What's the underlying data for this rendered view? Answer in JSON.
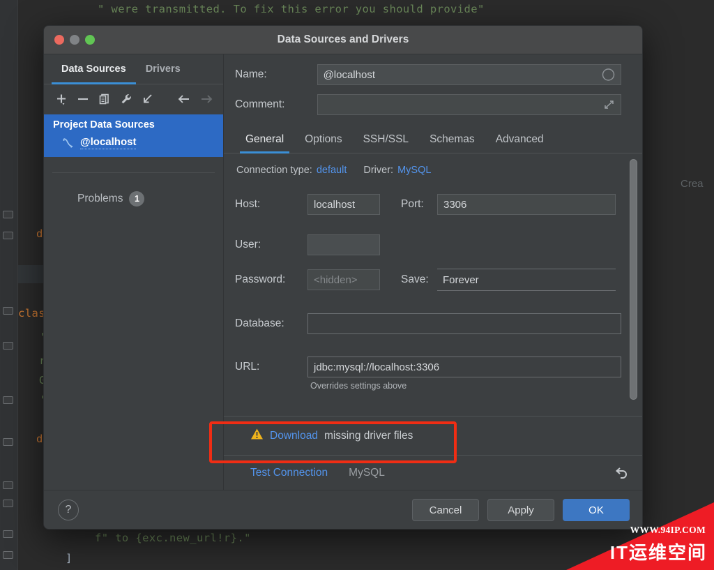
{
  "background": {
    "code_top": "\" were transmitted. To fix this error you should provide\"",
    "code_left_def1": "d",
    "code_left_class": "class",
    "code_left_str1": "\"",
    "code_left_str2": "r",
    "code_left_str3": "G",
    "code_left_str4": "\"",
    "code_left_def2": "d",
    "code_bottom_1": "f\" to {exc.new_url!r}.\"",
    "code_bottom_2": "]",
    "right_text": "Crea"
  },
  "dialog": {
    "title": "Data Sources and Drivers",
    "window_controls": {
      "close": "close-button",
      "minimize": "minimize-button",
      "maximize": "maximize-button"
    }
  },
  "sidebar": {
    "tabs": [
      {
        "label": "Data Sources",
        "active": true
      },
      {
        "label": "Drivers",
        "active": false
      }
    ],
    "toolbar": [
      {
        "icon": "add-icon",
        "name": "add-data-source-button",
        "enabled": true
      },
      {
        "icon": "remove-icon",
        "name": "remove-data-source-button",
        "enabled": true
      },
      {
        "icon": "duplicate-icon",
        "name": "duplicate-data-source-button",
        "enabled": true
      },
      {
        "icon": "wrench-icon",
        "name": "edit-driver-button",
        "enabled": true
      },
      {
        "icon": "import-icon",
        "name": "import-data-sources-button",
        "enabled": true
      },
      {
        "icon": "arrow-left-icon",
        "name": "navigate-back-button",
        "enabled": true
      },
      {
        "icon": "arrow-right-icon",
        "name": "navigate-forward-button",
        "enabled": false
      }
    ],
    "group_label": "Project Data Sources",
    "item_label": "@localhost",
    "item_icon": "mysql-datasource-icon",
    "problems_label": "Problems",
    "problems_count": "1"
  },
  "header": {
    "name_label": "Name:",
    "name_value": "@localhost",
    "name_icon": "color-circle-icon",
    "comment_label": "Comment:",
    "comment_value": "",
    "comment_placeholder": "",
    "comment_icon": "expand-icon"
  },
  "tabs": [
    {
      "label": "General",
      "active": true
    },
    {
      "label": "Options",
      "active": false
    },
    {
      "label": "SSH/SSL",
      "active": false
    },
    {
      "label": "Schemas",
      "active": false
    },
    {
      "label": "Advanced",
      "active": false
    }
  ],
  "general": {
    "connection_type_label": "Connection type:",
    "connection_type_value": "default",
    "driver_label": "Driver:",
    "driver_value": "MySQL",
    "host_label": "Host:",
    "host_value": "localhost",
    "port_label": "Port:",
    "port_value": "3306",
    "user_label": "User:",
    "user_value": "",
    "password_label": "Password:",
    "password_placeholder": "<hidden>",
    "save_label": "Save:",
    "save_value": "Forever",
    "database_label": "Database:",
    "database_value": "",
    "url_label": "URL:",
    "url_value": "jdbc:mysql://localhost:3306",
    "url_hint": "Overrides settings above"
  },
  "driver_notice": {
    "warning_icon": "warning-triangle-icon",
    "link_text": "Download",
    "rest_text": "missing driver files"
  },
  "status_bar": {
    "test_connection_label": "Test Connection",
    "driver_name": "MySQL",
    "revert_icon": "revert-icon"
  },
  "footer": {
    "help_label": "?",
    "cancel_label": "Cancel",
    "apply_label": "Apply",
    "ok_label": "OK"
  },
  "watermark": {
    "url": "WWW.94IP.COM",
    "name": "IT运维空间"
  },
  "colors": {
    "accent_blue": "#3b8fd6",
    "link_blue": "#5394ec",
    "selection_blue": "#2d6ac4",
    "primary_button": "#3d77c2",
    "warning_yellow": "#f0b41c",
    "annotation_red": "#f02d14",
    "watermark_red": "#ee1c25"
  }
}
